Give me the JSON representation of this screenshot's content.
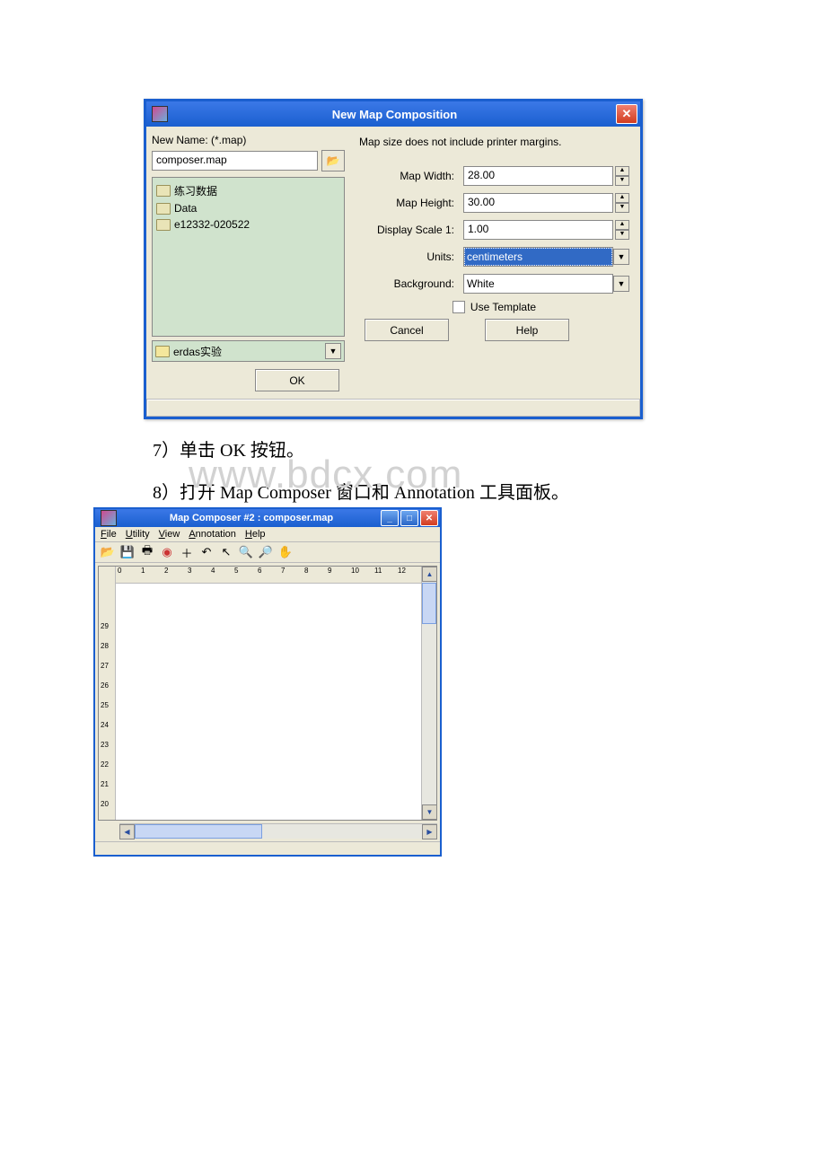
{
  "dialog": {
    "title": "New Map Composition",
    "new_name_label": "New Name: (*.map)",
    "filename": "composer.map",
    "folders": [
      "练习数据",
      "Data",
      "e12332-020522"
    ],
    "lookin": "erdas实验",
    "ok": "OK",
    "cancel": "Cancel",
    "help": "Help",
    "note": "Map size does not include printer margins.",
    "width_label": "Map Width:",
    "width_value": "28.00",
    "height_label": "Map Height:",
    "height_value": "30.00",
    "scale_label": "Display Scale 1:",
    "scale_value": "1.00",
    "units_label": "Units:",
    "units_value": "centimeters",
    "bg_label": "Background:",
    "bg_value": "White",
    "template_label": "Use Template"
  },
  "instructions": {
    "step7": "7）单击 OK 按钮。",
    "step8": "8）打开 Map Composer 窗口和 Annotation 工具面板。"
  },
  "composer": {
    "title": "Map Composer #2 : composer.map",
    "menus": {
      "file": "File",
      "utility": "Utility",
      "view": "View",
      "annotation": "Annotation",
      "help": "Help"
    },
    "hruler": [
      "0",
      "1",
      "2",
      "3",
      "4",
      "5",
      "6",
      "7",
      "8",
      "9",
      "10",
      "11",
      "12"
    ],
    "vruler": [
      "20",
      "21",
      "22",
      "23",
      "24",
      "25",
      "26",
      "27",
      "28",
      "29"
    ]
  },
  "watermark": "www.bdcx.com"
}
